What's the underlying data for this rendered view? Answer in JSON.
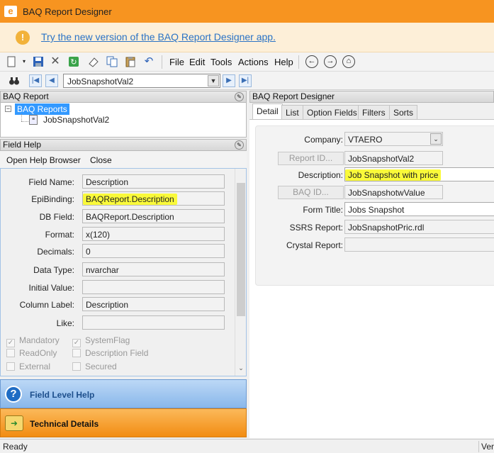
{
  "window": {
    "title": "BAQ Report Designer",
    "logo_letter": "e"
  },
  "banner": {
    "icon": "!",
    "link_text": "Try the new version of the BAQ Report Designer app."
  },
  "menu": [
    "File",
    "Edit",
    "Tools",
    "Actions",
    "Help"
  ],
  "toolbar_icons": [
    "new-icon",
    "save-icon",
    "delete-icon",
    "refresh-icon",
    "clear-icon",
    "copy-icon",
    "paste-icon",
    "undo-icon"
  ],
  "nav_icons": [
    "back-icon",
    "forward-icon",
    "home-icon"
  ],
  "record_nav": {
    "combo_value": "JobSnapshotVal2"
  },
  "left": {
    "baq_panel_title": "BAQ Report",
    "tree": {
      "root": "BAQ Reports",
      "child": "JobSnapshotVal2"
    },
    "field_help_title": "Field Help",
    "field_help_links": {
      "open_help_browser": "Open Help Browser",
      "close": "Close"
    },
    "fields": [
      {
        "label": "Field Name:",
        "value": "Description",
        "highlight": false
      },
      {
        "label": "EpiBinding:",
        "value": "BAQReport.Description",
        "highlight": true
      },
      {
        "label": "DB Field:",
        "value": "BAQReport.Description",
        "highlight": false
      },
      {
        "label": "Format:",
        "value": "x(120)",
        "highlight": false
      },
      {
        "label": "Decimals:",
        "value": "0",
        "highlight": false
      },
      {
        "label": "Data Type:",
        "value": "nvarchar",
        "highlight": false
      },
      {
        "label": "Initial Value:",
        "value": "",
        "highlight": false
      },
      {
        "label": "Column Label:",
        "value": "Description",
        "highlight": false
      },
      {
        "label": "Like:",
        "value": "",
        "highlight": false
      }
    ],
    "checkboxes": [
      {
        "label": "Mandatory",
        "checked": true
      },
      {
        "label": "SystemFlag",
        "checked": true
      },
      {
        "label": "ReadOnly",
        "checked": false
      },
      {
        "label": "Description Field",
        "checked": false
      },
      {
        "label": "External",
        "checked": false
      },
      {
        "label": "Secured",
        "checked": false
      }
    ],
    "field_level_help": "Field Level Help",
    "technical_details": "Technical Details"
  },
  "right": {
    "panel_title": "BAQ Report Designer",
    "tabs": [
      "Detail",
      "List",
      "Option Fields",
      "Filters",
      "Sorts"
    ],
    "active_tab": "Detail",
    "form": {
      "company_label": "Company:",
      "company_value": "VTAERO",
      "report_id_button": "Report ID...",
      "report_id_value": "JobSnapshotVal2",
      "description_label": "Description:",
      "description_value": "Job Snapshot with price",
      "baq_id_button": "BAQ ID...",
      "baq_id_value": "JobSnapshotwValue",
      "form_title_label": "Form Title:",
      "form_title_value": "Jobs Snapshot",
      "ssrs_label": "SSRS Report:",
      "ssrs_value": "JobSnapshotPric.rdl",
      "crystal_label": "Crystal Report:",
      "crystal_value": ""
    }
  },
  "status": {
    "left": "Ready",
    "right": "Vers"
  },
  "colors": {
    "accent": "#f79420",
    "highlight": "#fafa3a",
    "link": "#2a73c6"
  }
}
